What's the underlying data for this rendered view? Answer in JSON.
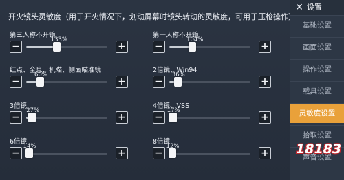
{
  "header": {
    "text": "开火镜头灵敏度（用于开火情况下，划动屏幕时镜头转动的灵敏度，可用于压枪操作）"
  },
  "sliders": [
    {
      "label": "第三人称不开镜",
      "value_text": "133%",
      "fraction": 0.37
    },
    {
      "label": "第一人称不开镜",
      "value_text": "104%",
      "fraction": 0.28
    },
    {
      "label": "红点、全息、机瞄、侧面瞄准镜",
      "value_text": "60%",
      "fraction": 0.17
    },
    {
      "label": "2倍镜、Win94",
      "value_text": "36%",
      "fraction": 0.1
    },
    {
      "label": "3倍镜",
      "value_text": "27%",
      "fraction": 0.07
    },
    {
      "label": "4倍镜、VSS",
      "value_text": "17%",
      "fraction": 0.04
    },
    {
      "label": "6倍镜",
      "value_text": "14%",
      "fraction": 0.03
    },
    {
      "label": "8倍镜",
      "value_text": "12%",
      "fraction": 0.03
    }
  ],
  "controls": {
    "minus": "−",
    "plus": "+"
  },
  "sidebar": {
    "title": "设置",
    "items": [
      {
        "label": "基础设置",
        "active": false
      },
      {
        "label": "画面设置",
        "active": false
      },
      {
        "label": "操作设置",
        "active": false
      },
      {
        "label": "载具设置",
        "active": false
      },
      {
        "label": "灵敏度设置",
        "active": true
      },
      {
        "label": "拾取设置",
        "active": false
      },
      {
        "label": "声音设置",
        "active": false
      }
    ]
  },
  "close": {
    "glyph": "✕"
  },
  "watermark": {
    "text": "18183"
  },
  "colors": {
    "accent": "#e9a13a",
    "panel": "#2b3442",
    "sidebar": "#2d3745"
  }
}
